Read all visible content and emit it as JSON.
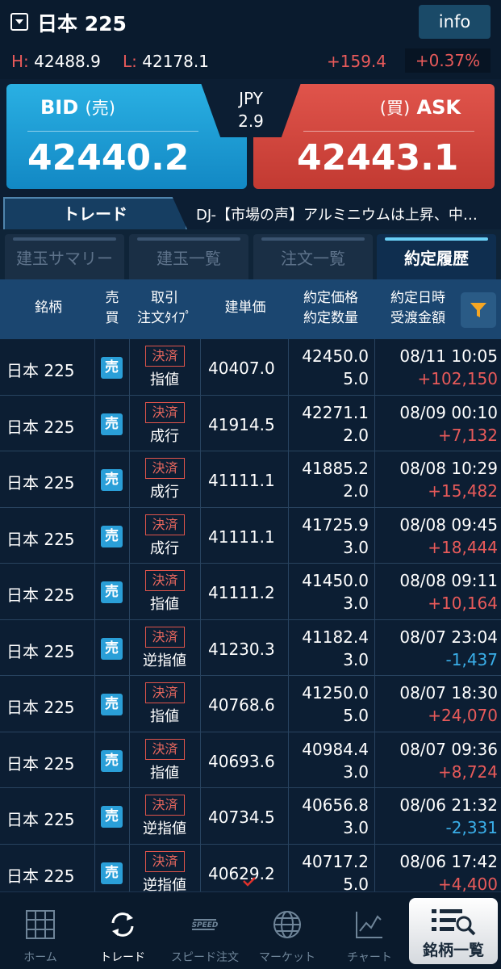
{
  "header": {
    "symbol": "日本 225",
    "info_label": "info",
    "high_label": "H:",
    "high_value": "42488.9",
    "low_label": "L:",
    "low_value": "42178.1",
    "change": "+159.4",
    "change_pct": "+0.37%"
  },
  "quote": {
    "bid_label": "BID",
    "bid_kana": "(売)",
    "bid_price": "42440.2",
    "ask_kana": "(買)",
    "ask_label": "ASK",
    "ask_price": "42443.1",
    "currency": "JPY",
    "spread": "2.9"
  },
  "trade_tab": "トレード",
  "news": "DJ-【市場の声】アルミニウムは上昇、中…",
  "subtabs": [
    "建玉サマリー",
    "建玉一覧",
    "注文一覧",
    "約定履歴"
  ],
  "table_headers": {
    "name": "銘柄",
    "side_1": "売",
    "side_2": "買",
    "type_1": "取引",
    "type_2": "注文ﾀｲﾌﾟ",
    "open": "建単価",
    "exec_1": "約定価格",
    "exec_2": "約定数量",
    "time_1": "約定日時",
    "time_2": "受渡金額"
  },
  "rows": [
    {
      "name": "日本 225",
      "side": "売",
      "badge": "決済",
      "type": "指値",
      "open": "40407.0",
      "exec": "42450.0",
      "qty": "5.0",
      "time": "08/11 10:05",
      "pl": "+102,150"
    },
    {
      "name": "日本 225",
      "side": "売",
      "badge": "決済",
      "type": "成行",
      "open": "41914.5",
      "exec": "42271.1",
      "qty": "2.0",
      "time": "08/09 00:10",
      "pl": "+7,132"
    },
    {
      "name": "日本 225",
      "side": "売",
      "badge": "決済",
      "type": "成行",
      "open": "41111.1",
      "exec": "41885.2",
      "qty": "2.0",
      "time": "08/08 10:29",
      "pl": "+15,482"
    },
    {
      "name": "日本 225",
      "side": "売",
      "badge": "決済",
      "type": "成行",
      "open": "41111.1",
      "exec": "41725.9",
      "qty": "3.0",
      "time": "08/08 09:45",
      "pl": "+18,444"
    },
    {
      "name": "日本 225",
      "side": "売",
      "badge": "決済",
      "type": "指値",
      "open": "41111.2",
      "exec": "41450.0",
      "qty": "3.0",
      "time": "08/08 09:11",
      "pl": "+10,164"
    },
    {
      "name": "日本 225",
      "side": "売",
      "badge": "決済",
      "type": "逆指値",
      "open": "41230.3",
      "exec": "41182.4",
      "qty": "3.0",
      "time": "08/07 23:04",
      "pl": "-1,437"
    },
    {
      "name": "日本 225",
      "side": "売",
      "badge": "決済",
      "type": "指値",
      "open": "40768.6",
      "exec": "41250.0",
      "qty": "5.0",
      "time": "08/07 18:30",
      "pl": "+24,070"
    },
    {
      "name": "日本 225",
      "side": "売",
      "badge": "決済",
      "type": "指値",
      "open": "40693.6",
      "exec": "40984.4",
      "qty": "3.0",
      "time": "08/07 09:36",
      "pl": "+8,724"
    },
    {
      "name": "日本 225",
      "side": "売",
      "badge": "決済",
      "type": "逆指値",
      "open": "40734.5",
      "exec": "40656.8",
      "qty": "3.0",
      "time": "08/06 21:32",
      "pl": "-2,331"
    },
    {
      "name": "日本 225",
      "side": "売",
      "badge": "決済",
      "type": "逆指値",
      "open": "40629.2",
      "exec": "40717.2",
      "qty": "5.0",
      "time": "08/06 17:42",
      "pl": "+4,400"
    }
  ],
  "nav": {
    "home": "ホーム",
    "trade": "トレード",
    "speed_order": "スピード注文",
    "speed_icon_text": "SPEED",
    "market": "マーケット",
    "chart": "チャート",
    "symbol_list": "銘柄一覧"
  },
  "colors": {
    "bid": "#1a9ad6",
    "ask": "#d54a41",
    "positive": "#e85a5a",
    "negative": "#3aaee8"
  }
}
